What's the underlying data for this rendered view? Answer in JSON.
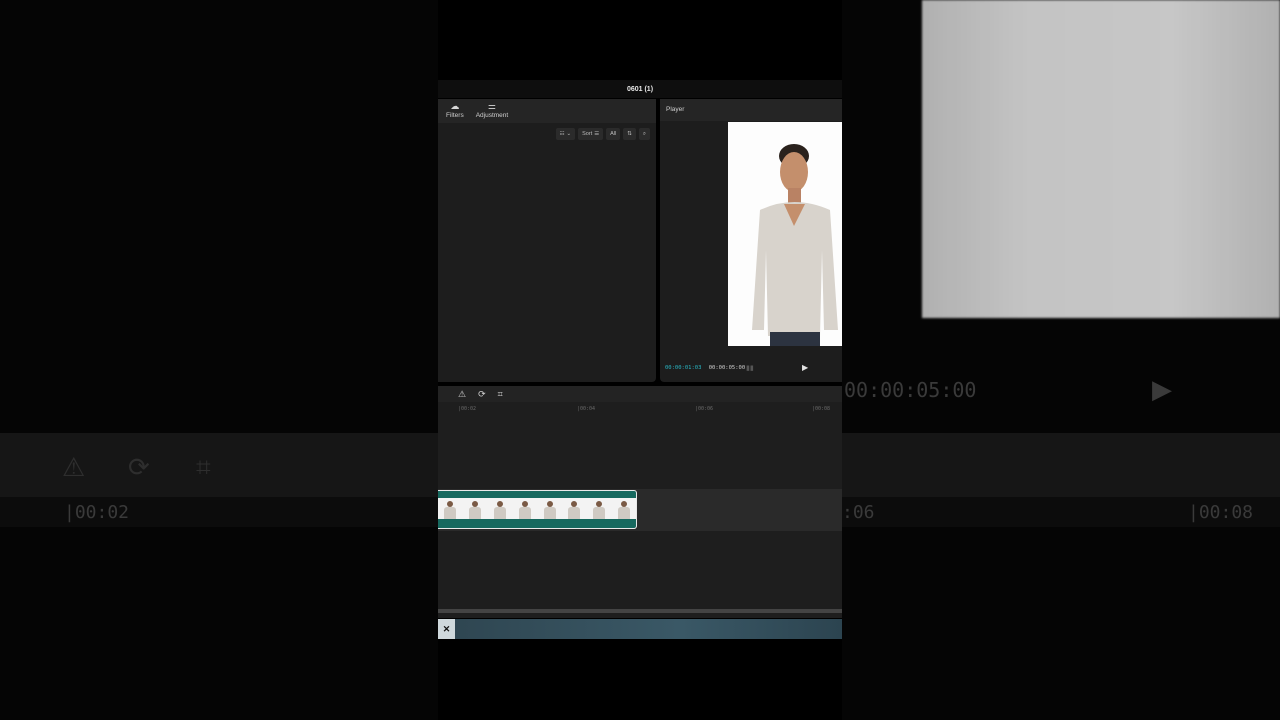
{
  "window": {
    "title": "0601 (1)"
  },
  "media_panel": {
    "tabs": [
      {
        "icon": "filters-icon",
        "label": "Filters"
      },
      {
        "icon": "adjustment-icon",
        "label": "Adjustment"
      }
    ],
    "toolbar": {
      "view_glyph": "☷",
      "sort_label": "Sort",
      "filter_label": "All"
    }
  },
  "player": {
    "label": "Player",
    "current_time": "00:00:01:03",
    "total_time": "00:00:05:00"
  },
  "timeline": {
    "ticks": [
      "|00:02",
      "|00:04",
      "|00:06",
      "|00:08"
    ],
    "clip_frames": 8
  },
  "background": {
    "left_time": "|00:02",
    "right_time_a": "00:00:05:00",
    "right_time_b": ":06",
    "right_time_c": "|00:08"
  },
  "colors": {
    "accent": "#28b6c4",
    "clip": "#17695f"
  }
}
